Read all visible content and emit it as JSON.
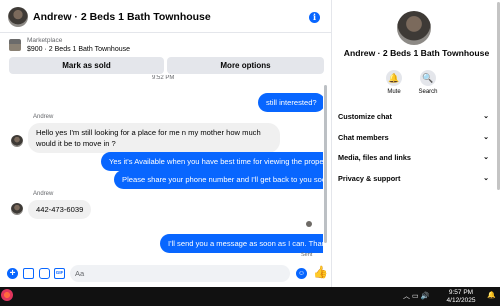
{
  "header": {
    "title": "Andrew · 2 Beds 1 Bath Townhouse",
    "info_icon": "i"
  },
  "marketplace": {
    "label": "Marketplace",
    "listing": "$900 · 2 Beds 1 Bath Townhouse"
  },
  "actions": {
    "mark_sold": "Mark as sold",
    "more_options": "More options"
  },
  "messages": {
    "top_time": "9:52 PM",
    "m1": "still interested?",
    "sender1": "Andrew",
    "m2": "Hello yes I'm still looking for a place for me n my mother how much would it be to move in ?",
    "m3": "Yes it's Available when you have best time for viewing the property",
    "m4": "Please share your phone number and I'll get back to you soon",
    "sender2": "Andrew",
    "m5": "442-473-6039",
    "m6": "I'll send you a message as soon as I can. Thanks",
    "status": "Sent"
  },
  "composer": {
    "placeholder": "Aa",
    "gif_label": "GIF"
  },
  "details": {
    "name": "Andrew · 2 Beds 1 Bath Townhouse",
    "mute_label": "Mute",
    "search_label": "Search",
    "rows": [
      "Customize chat",
      "Chat members",
      "Media, files and links",
      "Privacy & support"
    ]
  },
  "taskbar": {
    "time": "9:57 PM",
    "date": "4/12/2025"
  },
  "colors": {
    "accent": "#0866ff",
    "incoming_bubble": "#f0f0f0",
    "button_gray": "#e4e6eb"
  }
}
